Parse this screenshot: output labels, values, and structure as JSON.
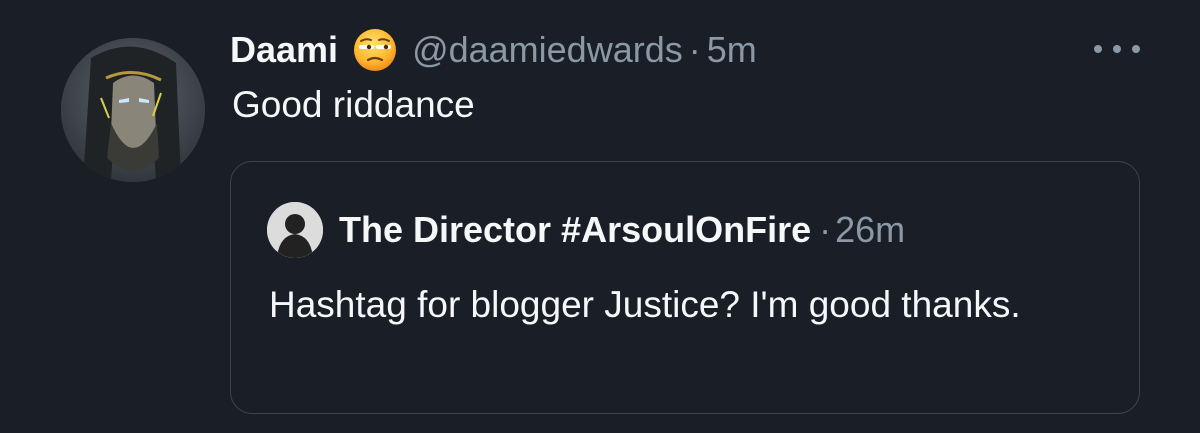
{
  "tweet": {
    "display_name": "Daami",
    "name_emoji": "unamused-face-emoji",
    "handle": "@daamiedwards",
    "separator": "·",
    "time": "5m",
    "more_icon": "more-horizontal-icon",
    "text": "Good riddance"
  },
  "quoted_tweet": {
    "display_name": "The Director #ArsoulOnFire",
    "separator": "·",
    "time": "26m",
    "text": "Hashtag for blogger Justice? I'm good thanks."
  },
  "colors": {
    "background": "#1a1f27",
    "primary_text": "#f5f7f9",
    "secondary_text": "#8b98a5",
    "border": "#3d4650"
  }
}
